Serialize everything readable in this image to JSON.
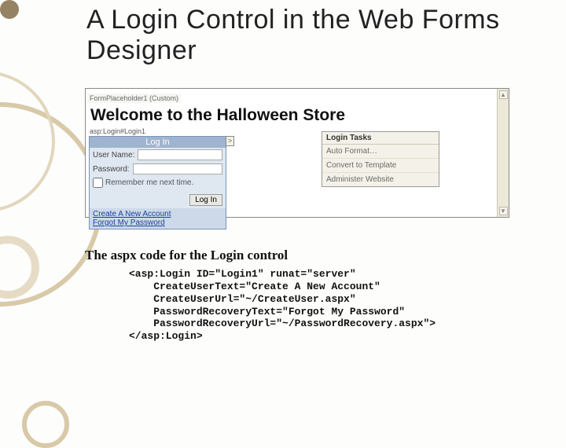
{
  "title": "A Login Control in the Web Forms Designer",
  "designer": {
    "placeholder_tag": "FormPlaceholder1 (Custom)",
    "welcome_heading": "Welcome to the Halloween Store",
    "control_tag": "asp:Login#Login1",
    "login": {
      "header": "Log In",
      "user_label": "User Name:",
      "user_value": "",
      "password_label": "Password:",
      "password_value": "",
      "remember_label": "Remember me next time.",
      "button_label": "Log In",
      "create_link": "Create A New Account",
      "forgot_link": "Forgot My Password"
    },
    "smart_tag_glyph": ">",
    "smart_panel": {
      "header": "Login Tasks",
      "items": [
        "Auto Format…",
        "Convert to Template",
        "Administer Website"
      ]
    },
    "scroll_up": "▲",
    "scroll_down": "▼"
  },
  "code": {
    "title": "The aspx code for the Login control",
    "lines": [
      "<asp:Login ID=\"Login1\" runat=\"server\"",
      "    CreateUserText=\"Create A New Account\"",
      "    CreateUserUrl=\"~/CreateUser.aspx\"",
      "    PasswordRecoveryText=\"Forgot My Password\"",
      "    PasswordRecoveryUrl=\"~/PasswordRecovery.aspx\">",
      "</asp:Login>"
    ]
  }
}
